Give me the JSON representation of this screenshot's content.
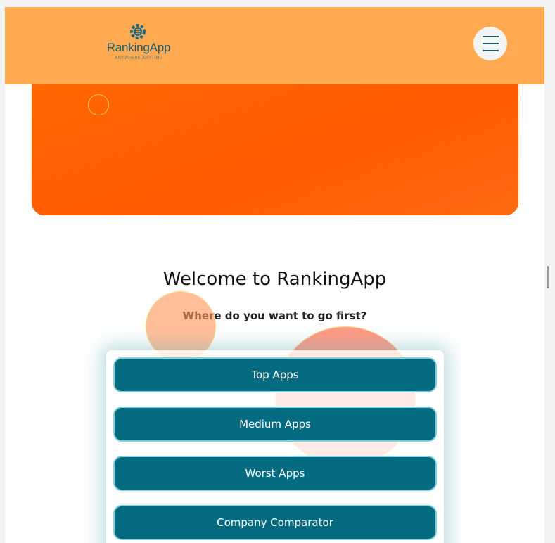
{
  "header": {
    "logo_text": "RankingApp",
    "logo_tagline": "ANYWHERE ANYTIME",
    "logo_icon": "gear-icon",
    "menu_icon": "hamburger-menu-icon",
    "background_color": "#ffaa50"
  },
  "hero": {
    "background_color": "#ff5a00"
  },
  "main": {
    "title": "Welcome to RankingApp",
    "subtitle": "Where do you want to go first?"
  },
  "nav": {
    "buttons": [
      {
        "label": "Top Apps"
      },
      {
        "label": "Medium Apps"
      },
      {
        "label": "Worst Apps"
      },
      {
        "label": "Company Comparator"
      }
    ],
    "button_color": "#056b80",
    "button_border_color": "#7fd0dd"
  }
}
